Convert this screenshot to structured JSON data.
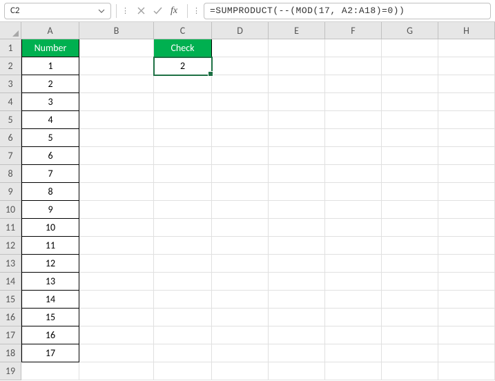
{
  "nameBox": {
    "value": "C2"
  },
  "formulaBar": {
    "formula": "=SUMPRODUCT(--(MOD(17, A2:A18)=0))"
  },
  "columns": [
    "A",
    "B",
    "C",
    "D",
    "E",
    "F",
    "G",
    "H"
  ],
  "rowCount": 19,
  "colors": {
    "headerFill": "#00b050",
    "selection": "#1d7044"
  },
  "headers": {
    "A1": "Number",
    "C1": "Check"
  },
  "selectedCell": "C2",
  "cells": {
    "A2": "1",
    "A3": "2",
    "A4": "3",
    "A5": "4",
    "A6": "5",
    "A7": "6",
    "A8": "7",
    "A9": "8",
    "A10": "9",
    "A11": "10",
    "A12": "11",
    "A13": "12",
    "A14": "13",
    "A15": "14",
    "A16": "15",
    "A17": "16",
    "A18": "17",
    "C2": "2"
  }
}
